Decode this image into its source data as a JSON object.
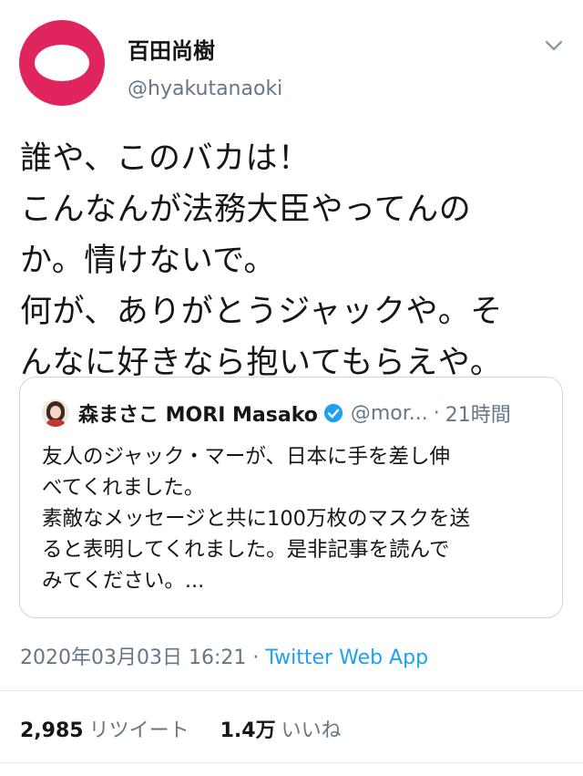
{
  "tweet": {
    "author": {
      "display_name": "百田尚樹",
      "handle": "@hyakutanaoki",
      "avatar_color": "#e0245e"
    },
    "text": "誰や、このバカは！\nこんなんが法務大臣やってんの\nか。情けないで。\n何が、ありがとうジャックや。そ\nんなに好きなら抱いてもらえや。",
    "menu_icon": "chevron-down-icon",
    "quoted": {
      "display_name": "森まさこ MORI Masako",
      "handle": "@mor...",
      "separator": "·",
      "time": "21時間",
      "verified_icon": "verified-badge-icon",
      "text": "友人のジャック・マーが、日本に手を差し伸\nべてくれました。\n素敵なメッセージと共に100万枚のマスクを送\nると表明してくれました。是非記事を読んで\nみてください。..."
    },
    "timestamp": "2020年03月03日 16:21",
    "separator": "·",
    "source_app": "Twitter Web App",
    "stats": {
      "retweet_count": "2,985",
      "retweet_label": "リツイート",
      "like_count": "1.4万",
      "like_label": "いいね"
    }
  },
  "colors": {
    "text_primary": "#14171a",
    "text_secondary": "#657786",
    "link": "#1da1f2",
    "border": "#ccd6dd"
  }
}
